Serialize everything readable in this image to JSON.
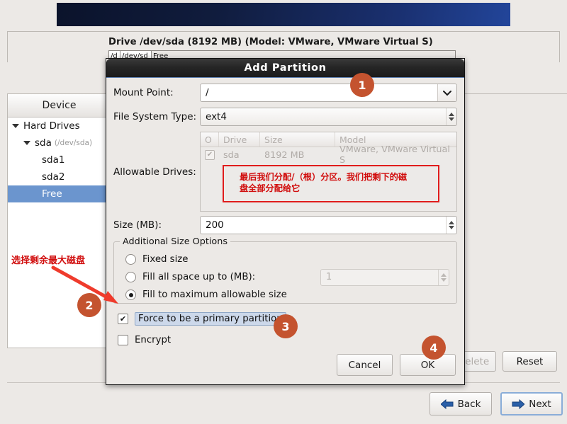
{
  "banner": {
    "name": "installer-banner"
  },
  "background": {
    "drive_title": "Drive /dev/sda (8192 MB) (Model: VMware, VMware Virtual S)",
    "drive_bar_segments": [
      "/d",
      "/dev/sd",
      "Free"
    ],
    "tree_header": "Device",
    "tree_items": [
      {
        "label": "Hard Drives",
        "sub": "",
        "indent": 0,
        "expander": true,
        "selected": false
      },
      {
        "label": "sda",
        "sub": "(/dev/sda)",
        "indent": 1,
        "expander": true,
        "selected": false
      },
      {
        "label": "sda1",
        "sub": "",
        "indent": 2,
        "expander": false,
        "selected": false
      },
      {
        "label": "sda2",
        "sub": "",
        "indent": 2,
        "expander": false,
        "selected": false
      },
      {
        "label": "Free",
        "sub": "",
        "indent": 2,
        "expander": false,
        "selected": true
      }
    ],
    "delete_label": "Delete",
    "reset_label": "Reset",
    "back_label": "Back",
    "next_label": "Next"
  },
  "dialog": {
    "title": "Add Partition",
    "mount_point_label": "Mount Point:",
    "mount_point_value": "/",
    "mount_point_placeholder": "",
    "fs_type_label": "File System Type:",
    "fs_type_value": "ext4",
    "allowable_drives_label": "Allowable Drives:",
    "drives_columns": [
      "O",
      "Drive",
      "Size",
      "Model"
    ],
    "drives_rows": [
      {
        "checked": true,
        "drive": "sda",
        "size": "8192 MB",
        "model": "VMware, VMware Virtual S"
      }
    ],
    "size_label": "Size (MB):",
    "size_value": "200",
    "group_legend": "Additional Size Options",
    "radio_options": [
      {
        "label": "Fixed size",
        "selected": false
      },
      {
        "label": "Fill all space up to (MB):",
        "selected": false
      },
      {
        "label": "Fill to maximum allowable size",
        "selected": true
      }
    ],
    "fill_upto_value": "1",
    "force_primary_label": "Force to be a primary partition",
    "force_primary_checked": true,
    "encrypt_label": "Encrypt",
    "encrypt_checked": false,
    "cancel_label": "Cancel",
    "ok_label": "OK"
  },
  "annotations": {
    "red_box_text_line1": "最后我们分配/（根）分区。我们把剩下的磁",
    "red_box_text_line2": "盘全部分配给它",
    "left_text": "选择剩余最大磁盘",
    "color": "#d10d0d"
  },
  "badges": {
    "one": "1",
    "two": "2",
    "three": "3",
    "four": "4",
    "color": "#c4532f"
  }
}
